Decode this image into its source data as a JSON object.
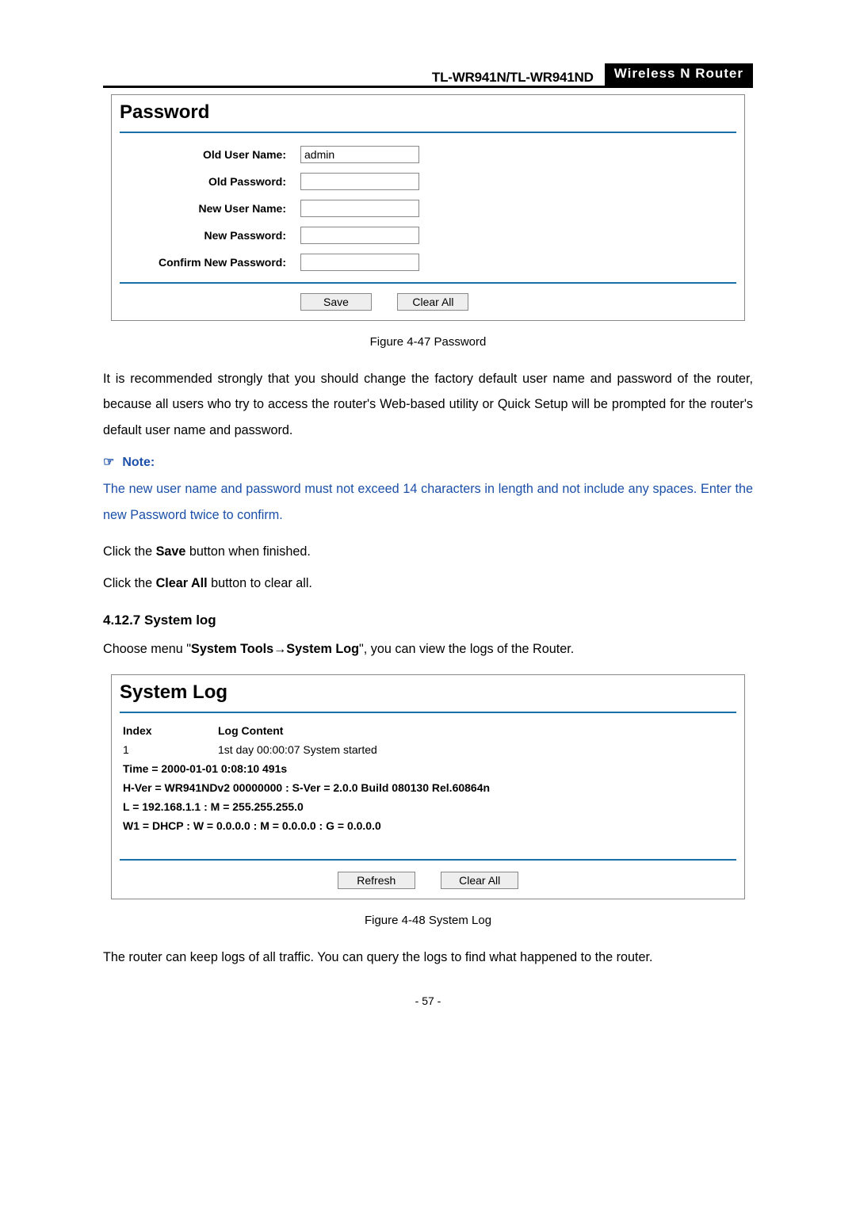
{
  "header": {
    "model": "TL-WR941N/TL-WR941ND",
    "badge": "Wireless  N  Router"
  },
  "password_panel": {
    "title": "Password",
    "fields": {
      "old_user_label": "Old User Name:",
      "old_user_value": "admin",
      "old_pw_label": "Old Password:",
      "new_user_label": "New User Name:",
      "new_pw_label": "New Password:",
      "confirm_pw_label": "Confirm New Password:"
    },
    "buttons": {
      "save": "Save",
      "clear": "Clear All"
    }
  },
  "captions": {
    "fig47": "Figure 4-47    Password",
    "fig48": "Figure 4-48    System Log"
  },
  "paragraphs": {
    "recommend": "It is recommended strongly that you should change the factory default user name and password of the router, because all users who try to access the router's Web-based utility or Quick Setup will be prompted for the router's default user name and password.",
    "note_label": "Note:",
    "note_body": "The new user name and password must not exceed 14 characters in length and not include any spaces. Enter the new Password twice to confirm.",
    "click_save_pre": "Click the ",
    "click_save_bold": "Save",
    "click_save_post": " button when finished.",
    "click_clear_pre": "Click the ",
    "click_clear_bold": "Clear All",
    "click_clear_post": " button to clear all.",
    "syslog_intro_pre": "Choose menu \"",
    "syslog_intro_b1": "System Tools",
    "syslog_intro_arrow": "→",
    "syslog_intro_b2": "System Log",
    "syslog_intro_post": "\", you can view the logs of the Router.",
    "after_syslog": "The router can keep logs of all traffic. You can query the logs to find what happened to the router."
  },
  "section": {
    "syslog_hdr": "4.12.7 System log"
  },
  "syslog_panel": {
    "title": "System Log",
    "headers": {
      "index": "Index",
      "content": "Log Content"
    },
    "rows": [
      {
        "index": "1",
        "content": "1st day 00:00:07 System started"
      }
    ],
    "info": [
      "Time = 2000-01-01 0:08:10 491s",
      "H-Ver = WR941NDv2 00000000 : S-Ver = 2.0.0 Build 080130 Rel.60864n",
      "L = 192.168.1.1 : M = 255.255.255.0",
      "W1 = DHCP : W = 0.0.0.0 : M = 0.0.0.0 : G = 0.0.0.0"
    ],
    "buttons": {
      "refresh": "Refresh",
      "clear": "Clear All"
    }
  },
  "page_number": "- 57 -"
}
